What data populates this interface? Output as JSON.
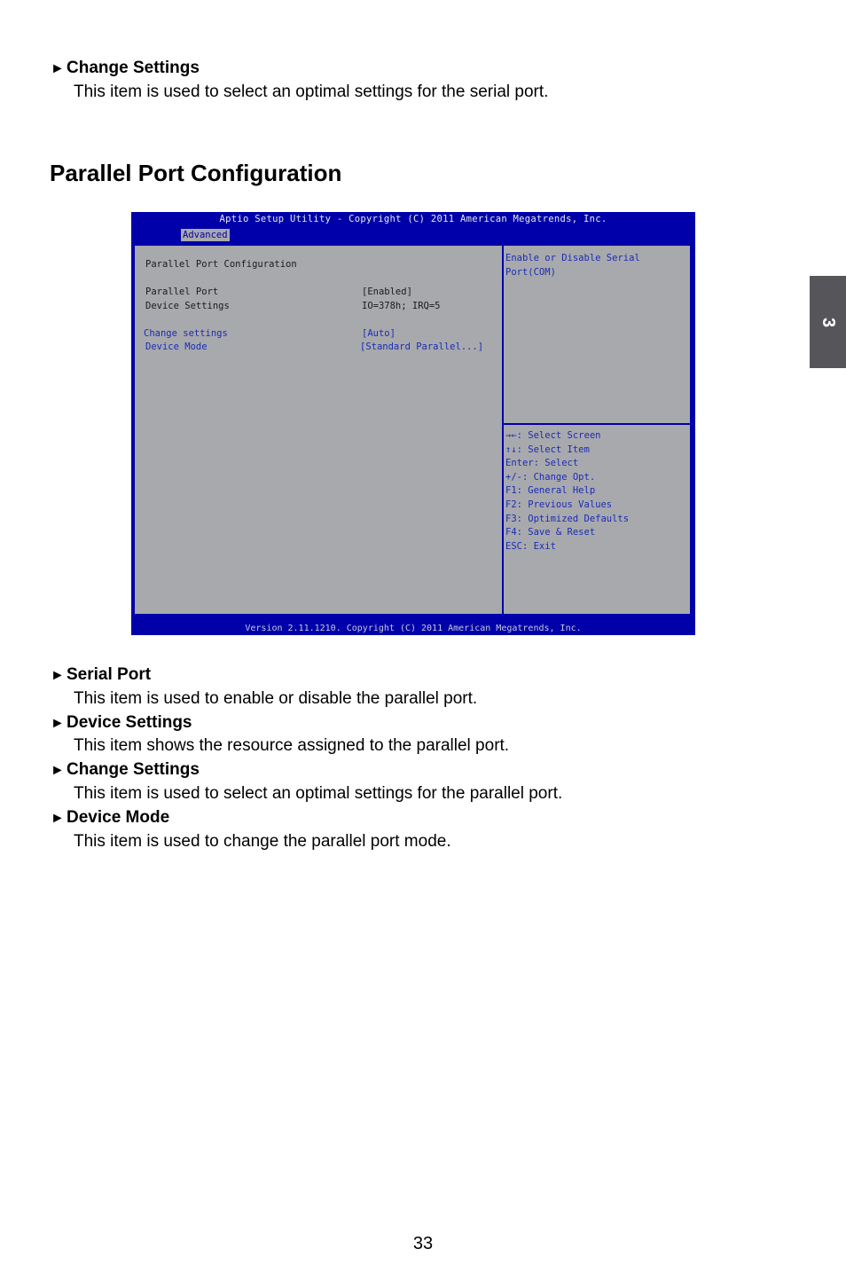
{
  "top_section": {
    "heading": "Change Settings",
    "description": "This item is used to select an optimal settings for the serial port."
  },
  "section_title": "Parallel Port Configuration",
  "bios": {
    "title": "Aptio Setup Utility - Copyright (C) 2011 American Megatrends, Inc.",
    "active_tab": "Advanced",
    "screen_heading": "Parallel Port Configuration",
    "settings": [
      {
        "label": "Parallel Port",
        "value": "[Enabled]",
        "selectable": false
      },
      {
        "label": "Device Settings",
        "value": "IO=378h; IRQ=5",
        "selectable": false
      },
      {
        "label": "Change settings",
        "value": "[Auto]",
        "selectable": true
      },
      {
        "label": "Device Mode",
        "value": "[Standard Parallel...]",
        "selectable": true
      }
    ],
    "help_text": [
      "Enable or Disable Serial",
      "Port(COM)"
    ],
    "key_help": [
      "→←: Select Screen",
      "↑↓: Select Item",
      "Enter: Select",
      "+/-: Change Opt.",
      "F1: General Help",
      "F2: Previous Values",
      "F3: Optimized Defaults",
      "F4: Save & Reset",
      "ESC: Exit"
    ],
    "footer": "Version 2.11.1210. Copyright (C) 2011 American Megatrends, Inc."
  },
  "items": [
    {
      "heading": "Serial Port",
      "description": "This item is used to enable or disable the parallel port."
    },
    {
      "heading": "Device Settings",
      "description": "This item shows the resource assigned to the parallel port."
    },
    {
      "heading": "Change Settings",
      "description": "This item is used to select an optimal settings for the parallel port."
    },
    {
      "heading": "Device Mode",
      "description": "This item is used to change the parallel port mode."
    }
  ],
  "bullet_glyph": "►",
  "chapter_tab": "3",
  "page_number": "33"
}
